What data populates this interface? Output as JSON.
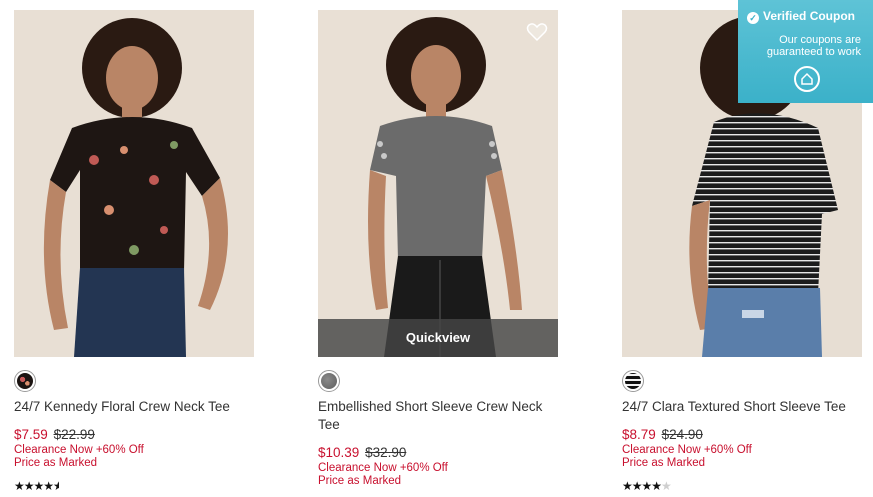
{
  "coupon_widget": {
    "title": "Verified Coupon",
    "subtitle": "Our coupons are guaranteed to work",
    "icon": "coupon-badge-icon",
    "accent": "#3bb1c9"
  },
  "products": [
    {
      "name": "24/7 Kennedy Floral Crew Neck Tee",
      "sale_price": "$7.59",
      "original_price": "$22.99",
      "promo_line1": "Clearance Now +60% Off",
      "promo_line2": "Price as Marked",
      "rating": 4.5,
      "stars": "★★★★",
      "stars_empty": "",
      "swatch": "black-floral"
    },
    {
      "name": "Embellished Short Sleeve Crew Neck Tee",
      "sale_price": "$10.39",
      "original_price": "$32.90",
      "promo_line1": "Clearance Now +60% Off",
      "promo_line2": "Price as Marked",
      "quickview_label": "Quickview",
      "swatch": "heather-gray"
    },
    {
      "name": "24/7 Clara Textured Short Sleeve Tee",
      "sale_price": "$8.79",
      "original_price": "$24.90",
      "promo_line1": "Clearance Now +60% Off",
      "promo_line2": "Price as Marked",
      "rating": 4,
      "stars": "★★★★",
      "stars_empty": "★",
      "swatch": "black-white-stripe"
    }
  ],
  "colors": {
    "sale_red": "#c8102e",
    "photo_bg": "#e6ddd2"
  }
}
